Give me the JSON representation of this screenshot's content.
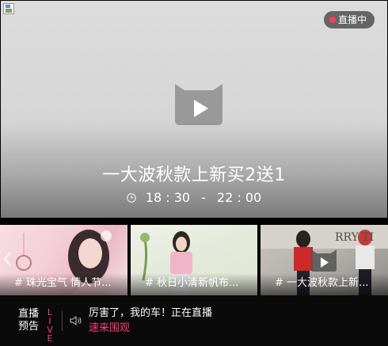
{
  "main": {
    "badge_label": "直播中",
    "title": "一大波秋款上新买2送1",
    "time_start": "18 : 30",
    "time_separator": "-",
    "time_end": "22 : 00"
  },
  "thumbnails": [
    {
      "caption": "# 珠光宝气 情人节..."
    },
    {
      "caption": "# 秋日小清新帆布..."
    },
    {
      "caption": "# 一大波秋款上新..."
    }
  ],
  "ticker": {
    "label_line1": "直播",
    "label_line2": "预告",
    "live_letters": [
      "L",
      "I",
      "V",
      "E"
    ],
    "message": "厉害了，我的车！正在直播",
    "cta": "速来围观"
  },
  "colors": {
    "accent": "#ff3a78",
    "badge_dot": "#ff3a5c",
    "ticker_bg": "#0a0a0a"
  },
  "icons": [
    "broken-image-icon",
    "live-dot-icon",
    "tmall-play-icon",
    "clock-icon",
    "chevron-left-icon",
    "speaker-icon"
  ]
}
